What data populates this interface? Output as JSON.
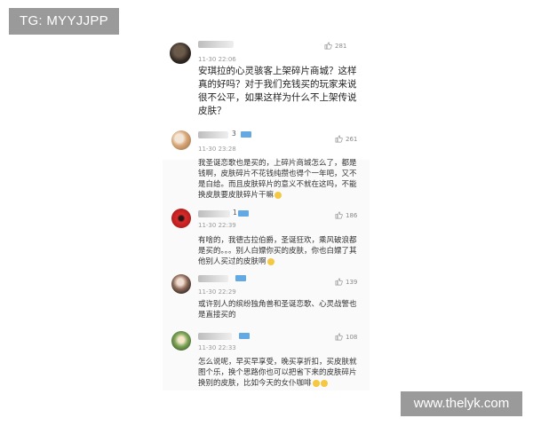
{
  "watermarks": {
    "left": "TG: MYYJJPP",
    "right": "www.thelyk.com"
  },
  "comment": {
    "time": "11-30 22:06",
    "likes": "281",
    "text": "安琪拉的心灵骇客上架碎片商城？这样真的好吗？对于我们充钱买的玩家来说很不公平，如果这样为什么不上架传说皮肤？"
  },
  "replies": [
    {
      "name_suffix": "3",
      "time": "11-30 23:28",
      "likes": "261",
      "text": "我圣诞恋歌也是买的，上碎片商城怎么了，都是钱啊，皮肤碎片不花钱纯攒也得个一年吧，又不是白给。而且皮肤碎片的意义不就在这吗，不能换皮肤要皮肤碎片干嘛",
      "avatar_icon": "flower-avatar"
    },
    {
      "name_suffix": "1",
      "time": "11-30 22:39",
      "likes": "186",
      "text": "有啥的，我德古拉伯爵，圣诞狂欢，乘风破浪都是买的。。。别人白嫖你买的皮肤，你也白嫖了其他别人买过的皮肤啊",
      "avatar_icon": "red-mask-avatar"
    },
    {
      "name_suffix": "",
      "time": "11-30 22:29",
      "likes": "139",
      "text": "或许别人的缤纷独角兽和圣诞恋歌、心灵战警也是直接买的",
      "avatar_icon": "girl-avatar"
    },
    {
      "name_suffix": "",
      "time": "11-30 22:33",
      "likes": "108",
      "text": "怎么说呢，早买早享受，晚买享折扣，买皮肤就图个乐，换个思路你也可以把省下来的皮肤碎片换别的皮肤，比如今天的女仆咖啡",
      "avatar_icon": "green-character-avatar"
    }
  ]
}
